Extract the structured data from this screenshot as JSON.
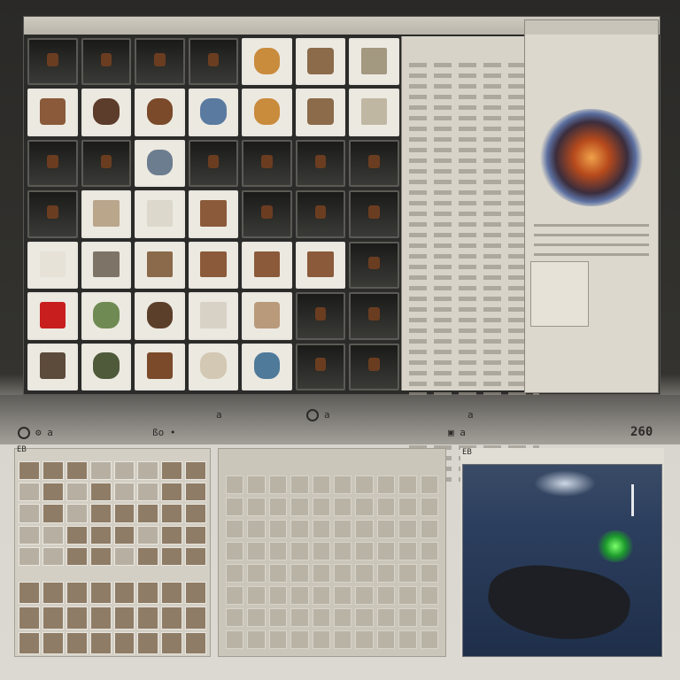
{
  "status_bar": {
    "left_label": "⚙ a",
    "left_mid": "ßo •",
    "center_top": "a",
    "center_icon_label": "a",
    "right_top": "a",
    "right_mid": "▣ a",
    "corner_value": "260"
  },
  "bottom": {
    "panel1_title": "EB",
    "panel3_title": "EB"
  },
  "colors": {
    "accent_glow": "#2ecc40",
    "scene_bg": "#2c3f5e"
  }
}
